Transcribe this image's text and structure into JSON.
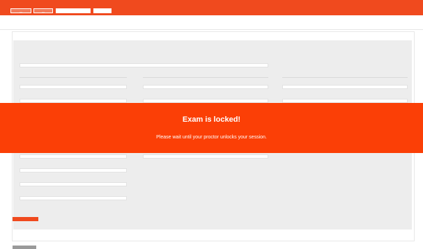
{
  "topbar": {
    "buttons": [
      "—",
      "—"
    ],
    "tab_active": "",
    "tab_secondary": ""
  },
  "brand": {
    "logo_main": "",
    "logo_accent": "",
    "tagline": ""
  },
  "page": {
    "card_title": ""
  },
  "instructions": "",
  "fields": {
    "id_label": "",
    "id_value": "",
    "personal_header": "",
    "contact_header": "",
    "id_header": "",
    "first_label": "",
    "first_value": "",
    "last_label": "",
    "last_value": "",
    "email_label": "",
    "email_value": "",
    "phone_label": "",
    "phone_value": "",
    "dob_label": "",
    "dob_value": "",
    "idnum_label": "",
    "idnum_value": "",
    "lower_value_1": "",
    "lower_value_2": "",
    "lower_label_3": "",
    "lower_value_3": "",
    "lower_label_4": "",
    "lower_value_4": "",
    "lower_label_5": "",
    "lower_value_5": ""
  },
  "overlay": {
    "title": "Exam is locked!",
    "message": "Please wait until your proctor unlocks your session."
  },
  "actions": {
    "submit": ""
  },
  "footer": {
    "button": "",
    "link": "",
    "text": ""
  },
  "colors": {
    "accent": "#f04a1e",
    "overlay": "#fb3f06",
    "panel": "#ededed"
  }
}
